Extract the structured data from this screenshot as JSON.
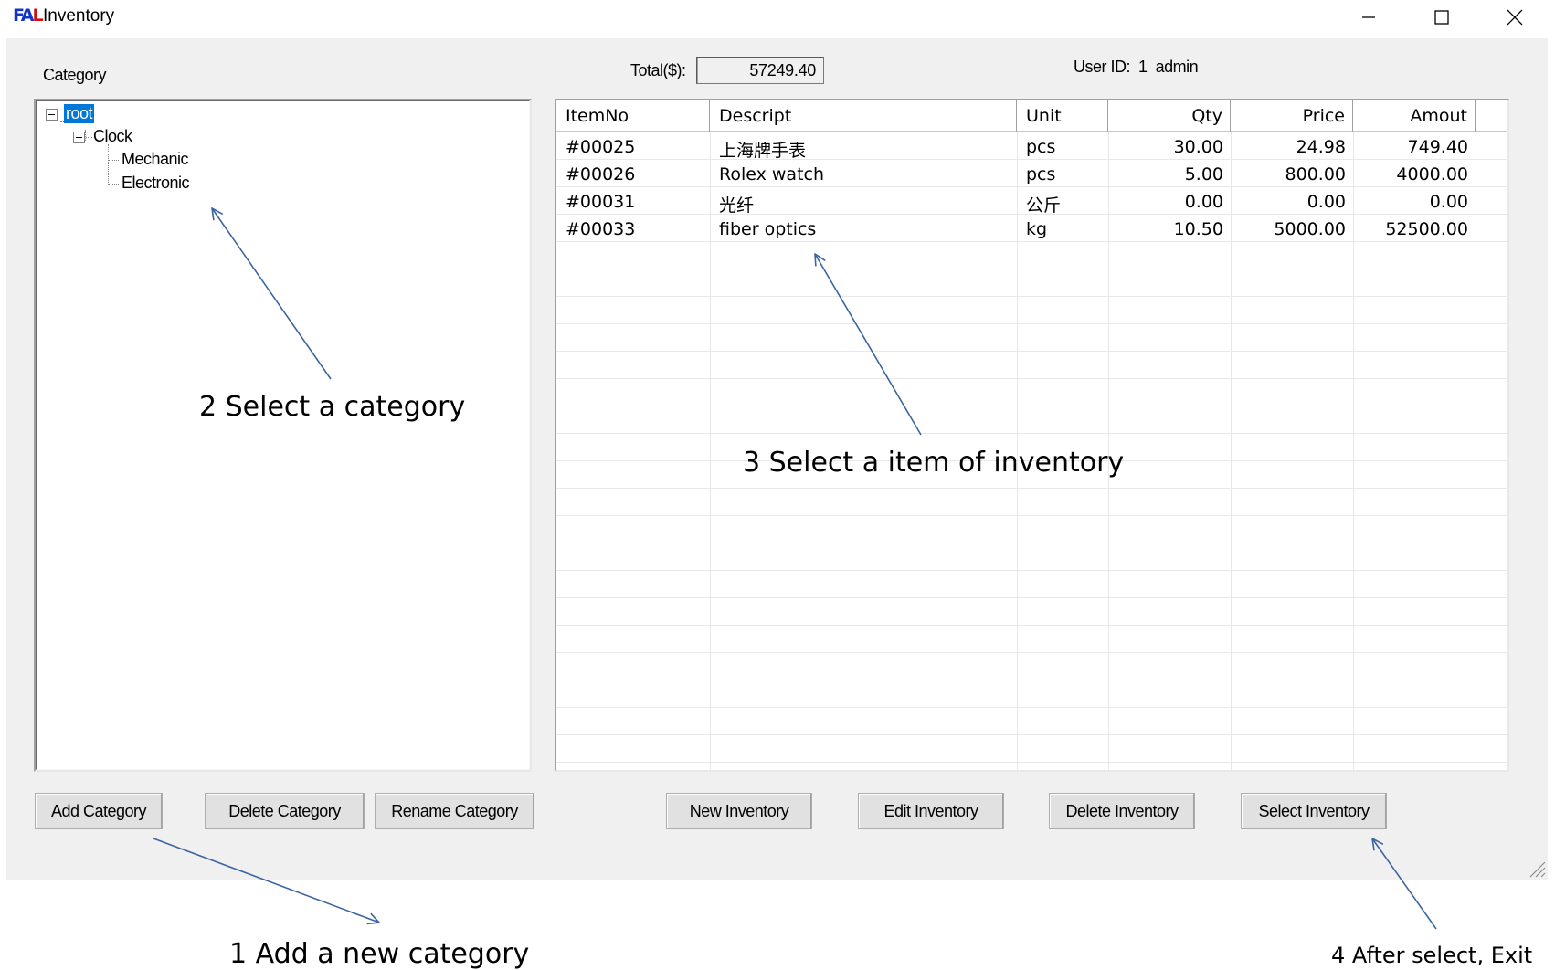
{
  "window": {
    "icon_text": "FAL",
    "title": "Inventory",
    "controls": {
      "minimize": "minimize-icon",
      "maximize": "maximize-icon",
      "close": "close-icon"
    }
  },
  "header": {
    "category_label": "Category",
    "total_label": "Total($):",
    "total_value": "57249.40",
    "user_label": "User ID:",
    "user_id": "1",
    "user_name": "admin"
  },
  "tree": {
    "nodes": [
      {
        "label": "root",
        "selected": true
      },
      {
        "label": "Clock"
      },
      {
        "label": "Mechanic"
      },
      {
        "label": "Electronic"
      }
    ]
  },
  "grid": {
    "columns": [
      "ItemNo",
      "Descript",
      "Unit",
      "Qty",
      "Price",
      "Amout"
    ],
    "rows": [
      [
        "#00025",
        "上海牌手表",
        "pcs",
        "30.00",
        "24.98",
        "749.40"
      ],
      [
        "#00026",
        "Rolex watch",
        "pcs",
        "5.00",
        "800.00",
        "4000.00"
      ],
      [
        "#00031",
        "光纤",
        "公斤",
        "0.00",
        "0.00",
        "0.00"
      ],
      [
        "#00033",
        "fiber optics",
        "kg",
        "10.50",
        "5000.00",
        "52500.00"
      ]
    ]
  },
  "buttons": {
    "add_category": "Add Category",
    "delete_category": "Delete Category",
    "rename_category": "Rename Category",
    "new_inventory": "New Inventory",
    "edit_inventory": "Edit Inventory",
    "delete_inventory": "Delete Inventory",
    "select_inventory": "Select Inventory"
  },
  "annotations": {
    "step1": "1 Add a new category",
    "step2": "2 Select a category",
    "step3": "3 Select a item of inventory",
    "step4": "4 After select, Exit"
  },
  "colors": {
    "selection": "#0078d7",
    "arrow": "#3c64a0",
    "dialog_bg": "#f0f0f0"
  }
}
